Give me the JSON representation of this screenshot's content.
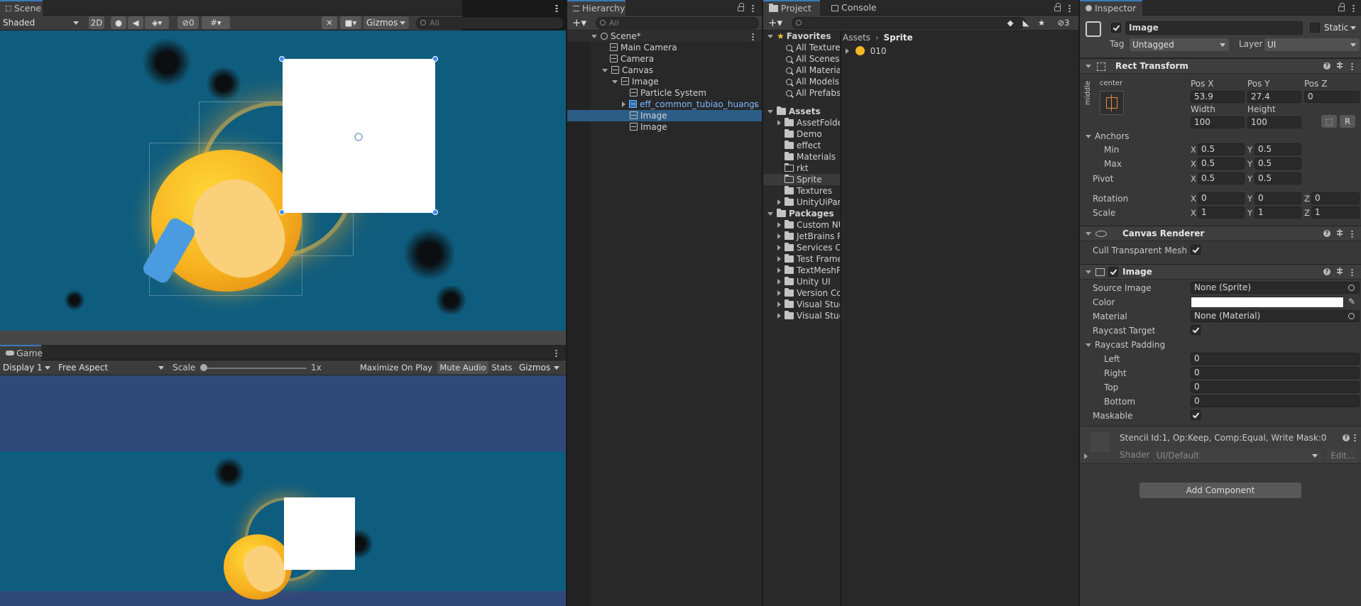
{
  "scene": {
    "tab": "Scene",
    "shading": "Shaded",
    "mode2d": "2D",
    "hidden_count": "0",
    "gizmos": "Gizmos",
    "search_placeholder": "All"
  },
  "game": {
    "tab": "Game",
    "display": "Display 1",
    "aspect": "Free Aspect",
    "scale_label": "Scale",
    "scale_value": "1x",
    "maximize": "Maximize On Play",
    "mute": "Mute Audio",
    "stats": "Stats",
    "gizmos": "Gizmos"
  },
  "hierarchy": {
    "tab": "Hierarchy",
    "search_placeholder": "All",
    "items": [
      {
        "label": "Scene*"
      },
      {
        "label": "Main Camera"
      },
      {
        "label": "Camera"
      },
      {
        "label": "Canvas"
      },
      {
        "label": "Image"
      },
      {
        "label": "Particle System"
      },
      {
        "label": "eff_common_tubiao_huangs"
      },
      {
        "label": "Image"
      },
      {
        "label": "Image"
      }
    ]
  },
  "project": {
    "tab_project": "Project",
    "tab_console": "Console",
    "hidden_count": "3",
    "favorites_label": "Favorites",
    "favorites": [
      "All Textures",
      "All Scenes",
      "All Materials",
      "All Models",
      "All Prefabs"
    ],
    "assets_label": "Assets",
    "assets": [
      "AssetFolder",
      "Demo",
      "effect",
      "Materials",
      "rkt",
      "Sprite",
      "Textures",
      "UnityUiParticles"
    ],
    "packages_label": "Packages",
    "packages": [
      "Custom NUnit",
      "JetBrains Rider",
      "Services Core",
      "Test Framework",
      "TextMeshPro",
      "Unity UI",
      "Version Control",
      "Visual Studio",
      "Visual Studio Code"
    ],
    "breadcrumb_root": "Assets",
    "breadcrumb_current": "Sprite",
    "file_name": "010"
  },
  "inspector": {
    "tab": "Inspector",
    "object_name": "Image",
    "static_label": "Static",
    "tag_label": "Tag",
    "tag_value": "Untagged",
    "layer_label": "Layer",
    "layer_value": "UI",
    "rect": {
      "title": "Rect Transform",
      "anchor_top": "center",
      "anchor_side": "middle",
      "posx_label": "Pos X",
      "posx": "53.9",
      "posy_label": "Pos Y",
      "posy": "27.4",
      "posz_label": "Pos Z",
      "posz": "0",
      "width_label": "Width",
      "width": "100",
      "height_label": "Height",
      "height": "100",
      "r_btn": "R",
      "anchors_label": "Anchors",
      "min_label": "Min",
      "min_x": "0.5",
      "min_y": "0.5",
      "max_label": "Max",
      "max_x": "0.5",
      "max_y": "0.5",
      "pivot_label": "Pivot",
      "pivot_x": "0.5",
      "pivot_y": "0.5",
      "rotation_label": "Rotation",
      "rot_x": "0",
      "rot_y": "0",
      "rot_z": "0",
      "scale_label": "Scale",
      "scale_x": "1",
      "scale_y": "1",
      "scale_z": "1",
      "x": "X",
      "y": "Y",
      "z": "Z"
    },
    "canvas_renderer": {
      "title": "Canvas Renderer",
      "cull_label": "Cull Transparent Mesh"
    },
    "image": {
      "title": "Image",
      "source_label": "Source Image",
      "source_value": "None (Sprite)",
      "color_label": "Color",
      "color_value": "#ffffff",
      "material_label": "Material",
      "material_value": "None (Material)",
      "raycast_target_label": "Raycast Target",
      "padding_label": "Raycast Padding",
      "left_label": "Left",
      "left": "0",
      "right_label": "Right",
      "right": "0",
      "top_label": "Top",
      "top": "0",
      "bottom_label": "Bottom",
      "bottom": "0",
      "maskable_label": "Maskable"
    },
    "material_preview": {
      "stencil": "Stencil Id:1, Op:Keep, Comp:Equal, Write Mask:0",
      "shader_label": "Shader",
      "shader_value": "UI/Default",
      "edit_btn": "Edit..."
    },
    "add_component": "Add Component"
  }
}
